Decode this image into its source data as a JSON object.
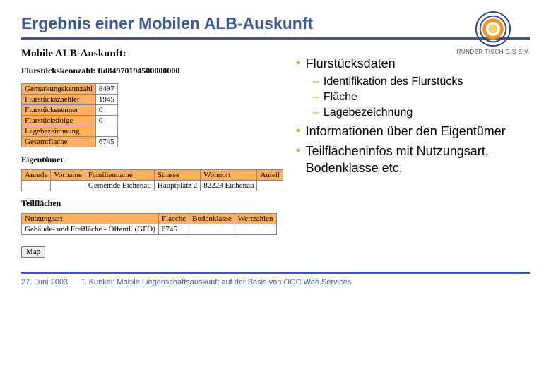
{
  "header": {
    "title": "Ergebnis einer Mobilen ALB-Auskunft",
    "org": "RUNDER TISCH GIS E.V."
  },
  "panel": {
    "heading": "Mobile ALB-Auskunft:",
    "kennzahl_label": "Flurstückskennzahl:",
    "kennzahl_value": "fid84970194500000000",
    "rows": [
      {
        "label": "Gemarkungskennzahl",
        "value": "8497"
      },
      {
        "label": "Flurstückszaehler",
        "value": "1945"
      },
      {
        "label": "Flurstücksnenner",
        "value": "0"
      },
      {
        "label": "Flurstücksfolge",
        "value": "0"
      },
      {
        "label": "Lagebezeichnung",
        "value": ""
      },
      {
        "label": "Gesamtflache",
        "value": "6745"
      }
    ],
    "owner_section": "Eigentümer",
    "owner_headers": [
      "Anrede",
      "Vorname",
      "Familienname",
      "Strasse",
      "Wohnort",
      "Anteil"
    ],
    "owner_row": [
      "",
      "",
      "Gemeinde Eichenau",
      "Hauptplatz 2",
      "82223 Eichenau",
      ""
    ],
    "areas_section": "Teilflächen",
    "areas_headers": [
      "Nutzungsart",
      "Flaeche",
      "Bodenklasse",
      "Wertzahlen"
    ],
    "areas_row": [
      "Gebäude- und Freifläche - Öffentl. (GFÖ)",
      "6745",
      "",
      ""
    ],
    "map_button": "Map"
  },
  "bullets": {
    "b1": "Flurstücksdaten",
    "s1": "Identifikation des Flurstücks",
    "s2": "Fläche",
    "s3": "Lagebezeichnung",
    "b2": "Informationen über den Eigentümer",
    "b3": "Teilflächeninfos mit Nutzungsart, Bodenklasse etc."
  },
  "footer": {
    "date": "27. Juni 2003",
    "author": "T. Kunkel: Mobile Liegenschaftsauskunft auf der Basis von OGC Web Services"
  }
}
